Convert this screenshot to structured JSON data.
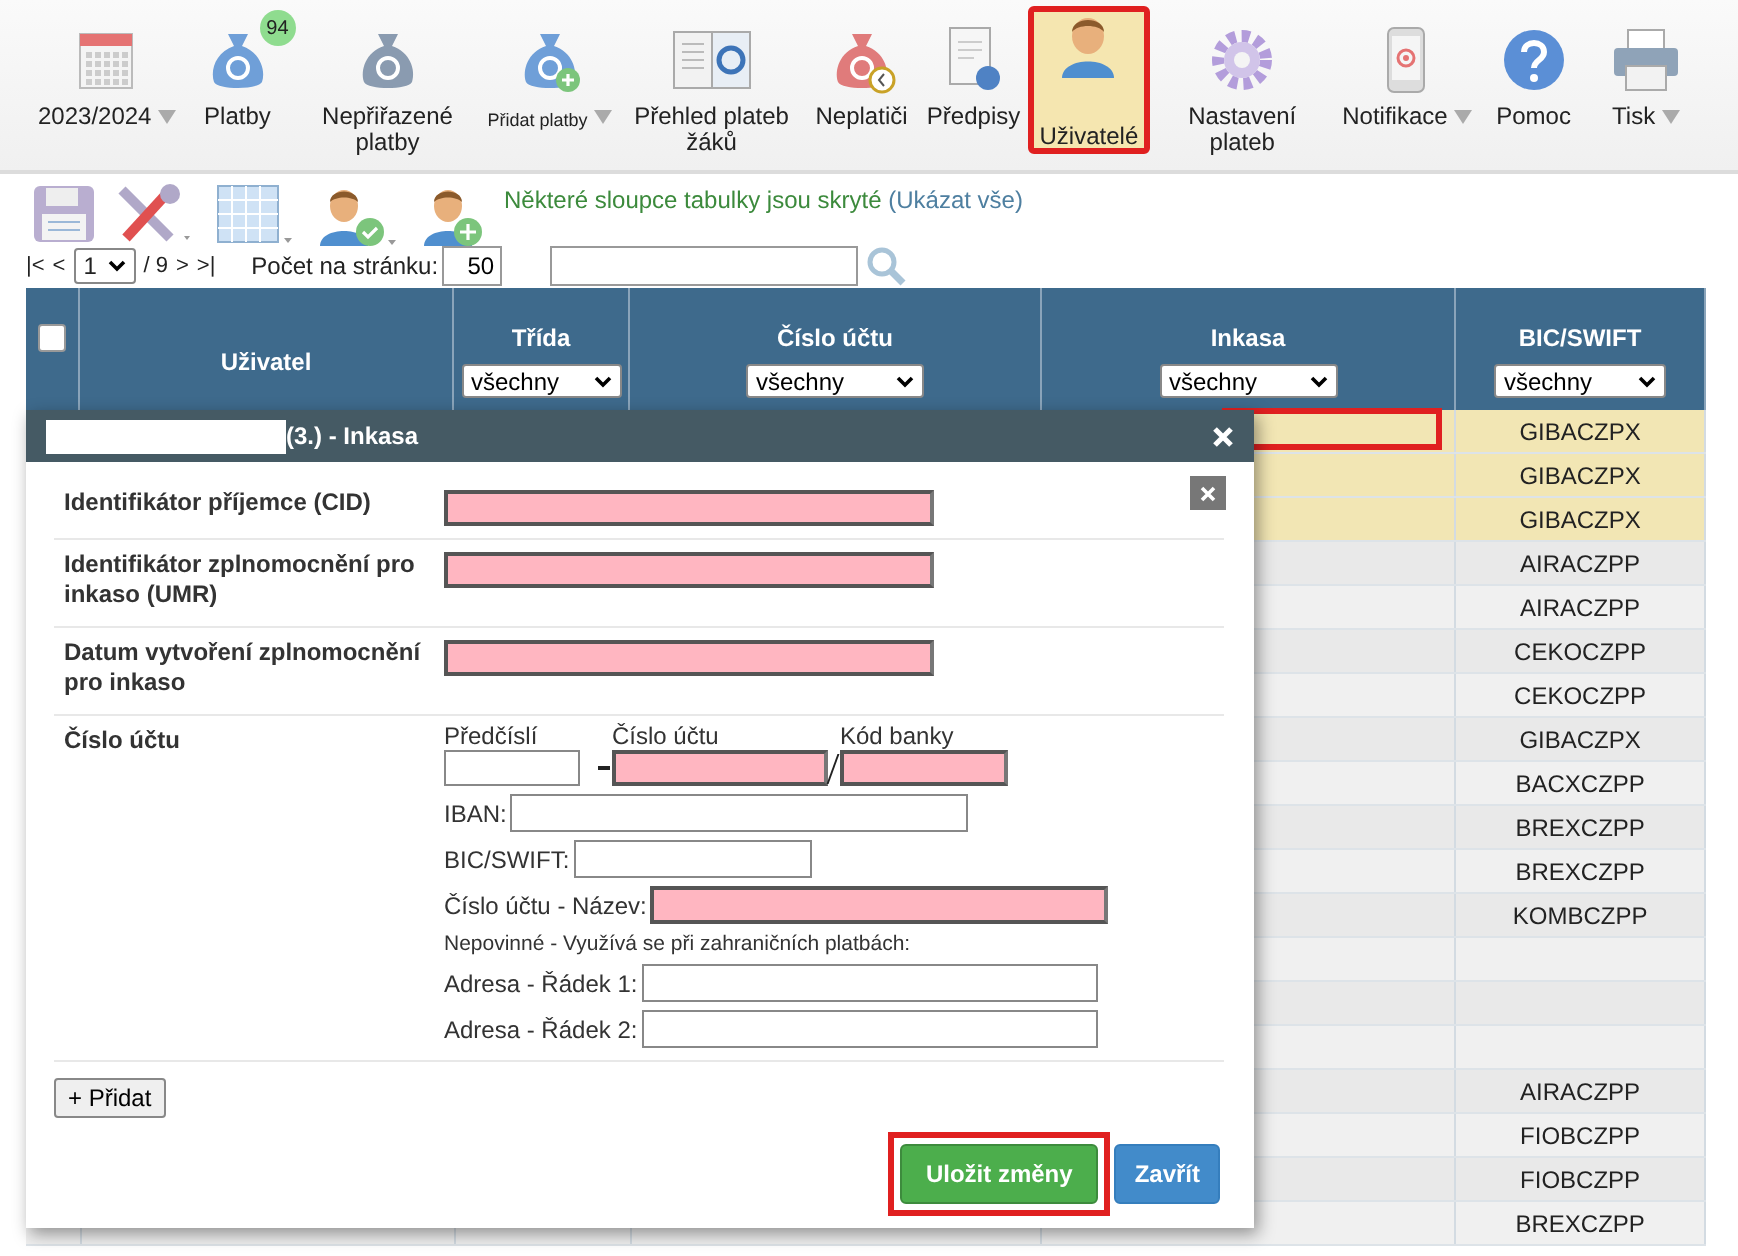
{
  "toolbar": {
    "items": [
      {
        "label": "2023/2024",
        "selected": false,
        "dropdown": true
      },
      {
        "label": "Platby",
        "selected": false,
        "dropdown": false,
        "badge": "94"
      },
      {
        "label": "Nepřiřazené platby",
        "selected": false,
        "dropdown": false
      },
      {
        "label": "Přidat platby",
        "selected": false,
        "dropdown": true
      },
      {
        "label": "Přehled plateb žáků",
        "selected": false,
        "dropdown": false
      },
      {
        "label": "Neplatiči",
        "selected": false,
        "dropdown": false
      },
      {
        "label": "Předpisy",
        "selected": false,
        "dropdown": false
      },
      {
        "label": "Uživatelé",
        "selected": true,
        "dropdown": false
      },
      {
        "label": "Nastavení plateb",
        "selected": false,
        "dropdown": false
      },
      {
        "label": "Notifikace",
        "selected": false,
        "dropdown": true
      },
      {
        "label": "Pomoc",
        "selected": false,
        "dropdown": false
      },
      {
        "label": "Tisk",
        "selected": false,
        "dropdown": true
      }
    ]
  },
  "notice": {
    "text": "Některé sloupce tabulky jsou skryté",
    "link": "(Ukázat vše)"
  },
  "pager": {
    "first": "|<",
    "prev": "<",
    "page": "1",
    "total": "/ 9",
    "next": ">",
    "last": ">|",
    "per_page_label": "Počet na stránku:",
    "per_page": "50"
  },
  "table": {
    "select_all_checked": false,
    "columns": [
      {
        "label": "Uživatel"
      },
      {
        "label": "Třída",
        "filter": "všechny"
      },
      {
        "label": "Číslo účtu",
        "filter": "všechny"
      },
      {
        "label": "Inkasa",
        "filter": "všechny"
      },
      {
        "label": "BIC/SWIFT",
        "filter": "všechny"
      }
    ],
    "rows": [
      {
        "bic": "GIBACZPX",
        "highlighted": true,
        "marked": true
      },
      {
        "bic": "GIBACZPX",
        "highlighted": true,
        "marked": false
      },
      {
        "bic": "GIBACZPX",
        "highlighted": true,
        "marked": false
      },
      {
        "bic": "AIRACZPP",
        "highlighted": false,
        "marked": false
      },
      {
        "bic": "AIRACZPP",
        "highlighted": false,
        "marked": false
      },
      {
        "bic": "CEKOCZPP",
        "highlighted": false,
        "marked": false
      },
      {
        "bic": "CEKOCZPP",
        "highlighted": false,
        "marked": false
      },
      {
        "bic": "GIBACZPX",
        "highlighted": false,
        "marked": false
      },
      {
        "bic": "BACXCZPP",
        "highlighted": false,
        "marked": false
      },
      {
        "bic": "BREXCZPP",
        "highlighted": false,
        "marked": false
      },
      {
        "bic": "BREXCZPP",
        "highlighted": false,
        "marked": false
      },
      {
        "bic": "KOMBCZPP",
        "highlighted": false,
        "marked": false
      },
      {
        "highlighted": false,
        "marked": false
      },
      {
        "highlighted": false,
        "marked": false
      },
      {
        "highlighted": false,
        "marked": false
      },
      {
        "bic": "AIRACZPP",
        "highlighted": false,
        "marked": false
      },
      {
        "bic": "FIOBCZPP",
        "highlighted": false,
        "marked": false
      },
      {
        "bic": "FIOBCZPP",
        "highlighted": false,
        "marked": false
      },
      {
        "bic": "BREXCZPP",
        "highlighted": false,
        "marked": false
      }
    ]
  },
  "modal": {
    "title": "(3.) - Inkasa",
    "fields": [
      {
        "label": "Identifikátor příjemce (CID)",
        "required": true
      },
      {
        "label": "Identifikátor zplnomocnění pro inkaso (UMR)",
        "required": true
      },
      {
        "label": "Datum vytvoření zplnomocnění pro inkaso",
        "required": true
      }
    ],
    "account": {
      "label": "Číslo účtu",
      "prefix": {
        "label": "Předčíslí",
        "required": false
      },
      "number": {
        "label": "Číslo účtu",
        "required": true
      },
      "bank": {
        "label": "Kód banky",
        "required": true
      },
      "iban": {
        "label": "IBAN:",
        "required": false
      },
      "bic": {
        "label": "BIC/SWIFT:",
        "required": false
      },
      "name": {
        "label": "Číslo účtu - Název:",
        "required": true
      },
      "note": "Nepovinné - Využívá se při zahraničních platbách:",
      "address1": {
        "label": "Adresa - Řádek 1:",
        "required": false
      },
      "address2": {
        "label": "Adresa - Řádek 2:",
        "required": false
      }
    },
    "add_button": "+ Přidat",
    "save_button": {
      "label": "Uložit změny",
      "marked": true
    },
    "close_button": "Zavřít"
  }
}
